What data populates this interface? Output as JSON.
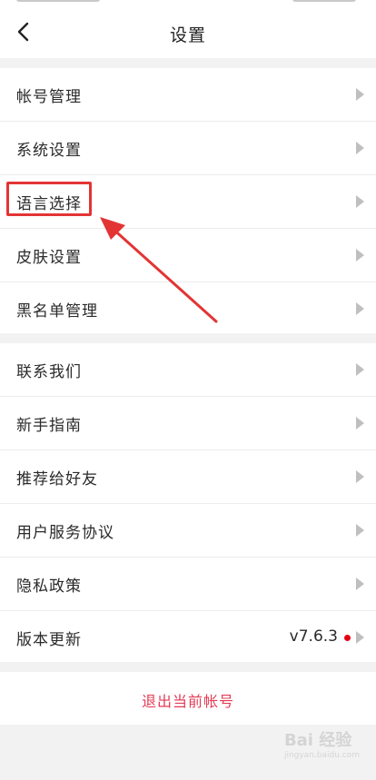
{
  "header": {
    "title": "设置"
  },
  "groups": {
    "account": [
      {
        "label": "帐号管理"
      },
      {
        "label": "系统设置"
      },
      {
        "label": "语言选择"
      },
      {
        "label": "皮肤设置"
      },
      {
        "label": "黑名单管理"
      }
    ],
    "about": [
      {
        "label": "联系我们"
      },
      {
        "label": "新手指南"
      },
      {
        "label": "推荐给好友"
      },
      {
        "label": "用户服务协议"
      },
      {
        "label": "隐私政策"
      },
      {
        "label": "版本更新",
        "value": "v7.6.3"
      }
    ]
  },
  "logout": {
    "label": "退出当前帐号"
  },
  "watermark": {
    "brand": "Bai 经验",
    "url": "jingyan.baidu.com"
  },
  "colors": {
    "accent_red": "#e43b55",
    "annotation_red": "#e33434",
    "new_dot": "#e60012"
  }
}
